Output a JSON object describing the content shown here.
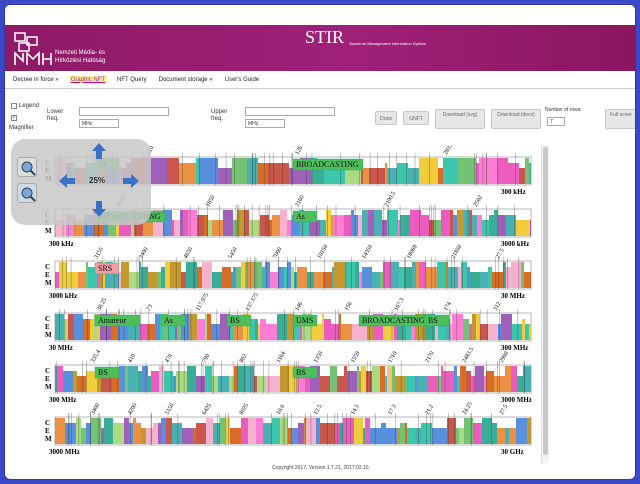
{
  "org": {
    "line1": "Nemzeti Média- és",
    "line2": "Hírközlési Hatóság"
  },
  "app": {
    "title": "STIR",
    "subtitle": "Spectrum Management Information System"
  },
  "menu": [
    {
      "label": "Decree in force »",
      "active": false
    },
    {
      "label": "Graphic NFT",
      "active": true
    },
    {
      "label": "NFT Query",
      "active": false
    },
    {
      "label": "Document storage »",
      "active": false
    },
    {
      "label": "User's Guide",
      "active": false
    }
  ],
  "toolbar": {
    "legend_label": "Legend",
    "magnifier_label": "Magnifier",
    "lower_freq_label": "Lower freq.",
    "lower_unit": "MHz",
    "upper_freq_label": "Upper freq.",
    "upper_unit": "MHz",
    "draw_label": "Draw",
    "gnft_label": "GNFT",
    "download_svg_label": "Download (svg)",
    "download_docx_label": "Download (docx)",
    "rows_label": "Number of rows:",
    "rows_value": "7",
    "full_screen_label": "Full scree"
  },
  "navigator": {
    "zoom_level": "25%"
  },
  "bands": [
    {
      "start": "",
      "end": "300 kHz",
      "markers": [
        "110",
        "126",
        "283.5"
      ],
      "labels": [
        "As",
        "BROADCASTING"
      ]
    },
    {
      "start": "300 kHz",
      "end": "3000 kHz",
      "markers": [
        "1635",
        "1850",
        "2160",
        "2190.5",
        "2502"
      ],
      "labels": [
        "BROADCASTING",
        "As"
      ]
    },
    {
      "start": "3000 kHz",
      "end": "30 MHz",
      "markers": [
        "3155",
        "3400",
        "4650",
        "5450",
        "7000",
        "10150",
        "14350",
        "18068",
        "21850",
        "27.5"
      ],
      "labels": [
        "SRS"
      ]
    },
    {
      "start": "30 MHz",
      "end": "300 MHz",
      "markers": [
        "38.25",
        "73",
        "117.975",
        "137.175",
        "146",
        "156",
        "167.3",
        "174",
        "312"
      ],
      "labels": [
        "Amateur",
        "As",
        "BS",
        "UMS",
        "BROADCASTING",
        "BS"
      ]
    },
    {
      "start": "300 MHz",
      "end": "3000 MHz",
      "markers": [
        "335.4",
        "410",
        "470",
        "790",
        "862",
        "1164",
        "1350",
        "1559",
        "1710",
        "2170",
        "2483.5",
        "2900"
      ],
      "labels": [
        "BS",
        "BS"
      ]
    },
    {
      "start": "3000 MHz",
      "end": "30 GHz",
      "markers": [
        "3400",
        "4200",
        "5150",
        "6425",
        "8025",
        "10.6",
        "12.5",
        "14.5",
        "17.3",
        "21.2",
        "24.25",
        "27.5"
      ],
      "labels": []
    }
  ],
  "footer": "Copyright 2017, Version 1.7.21, 2017.03.10."
}
